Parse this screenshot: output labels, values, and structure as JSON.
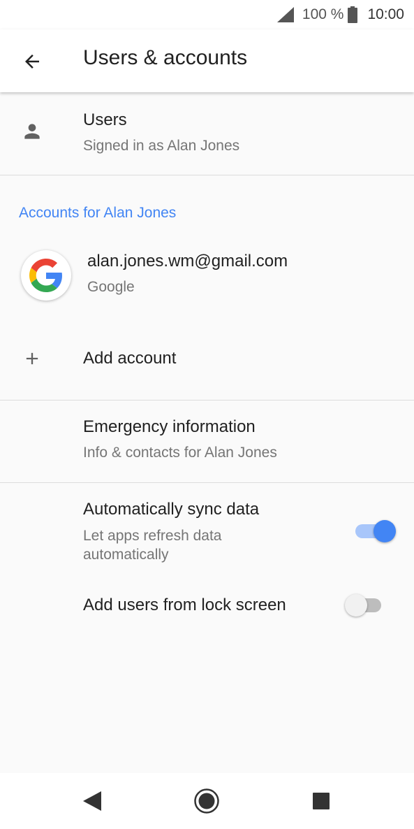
{
  "status_bar": {
    "battery_percent": "100 %",
    "time": "10:00",
    "icons": [
      "signal-icon",
      "battery-icon"
    ]
  },
  "app_bar": {
    "title": "Users & accounts",
    "back_icon": "arrow-back-icon"
  },
  "users": {
    "title": "Users",
    "summary": "Signed in as Alan Jones",
    "icon": "person-icon"
  },
  "accounts_section": {
    "header": "Accounts for Alan Jones",
    "header_color": "#4285f4",
    "items": [
      {
        "email": "alan.jones.wm@gmail.com",
        "type": "Google",
        "icon": "google-icon"
      }
    ],
    "add_account": {
      "label": "Add account",
      "icon": "plus-icon"
    }
  },
  "emergency": {
    "title": "Emergency information",
    "summary": "Info & contacts for Alan Jones"
  },
  "auto_sync": {
    "title": "Automatically sync data",
    "summary": "Let apps refresh data automatically",
    "enabled": true
  },
  "lock_screen_users": {
    "title": "Add users from lock screen",
    "enabled": false
  },
  "nav_bar": {
    "icons": [
      "back-triangle-icon",
      "home-circle-icon",
      "recents-square-icon"
    ]
  },
  "colors": {
    "accent": "#4285f4",
    "background": "#fafafa"
  }
}
